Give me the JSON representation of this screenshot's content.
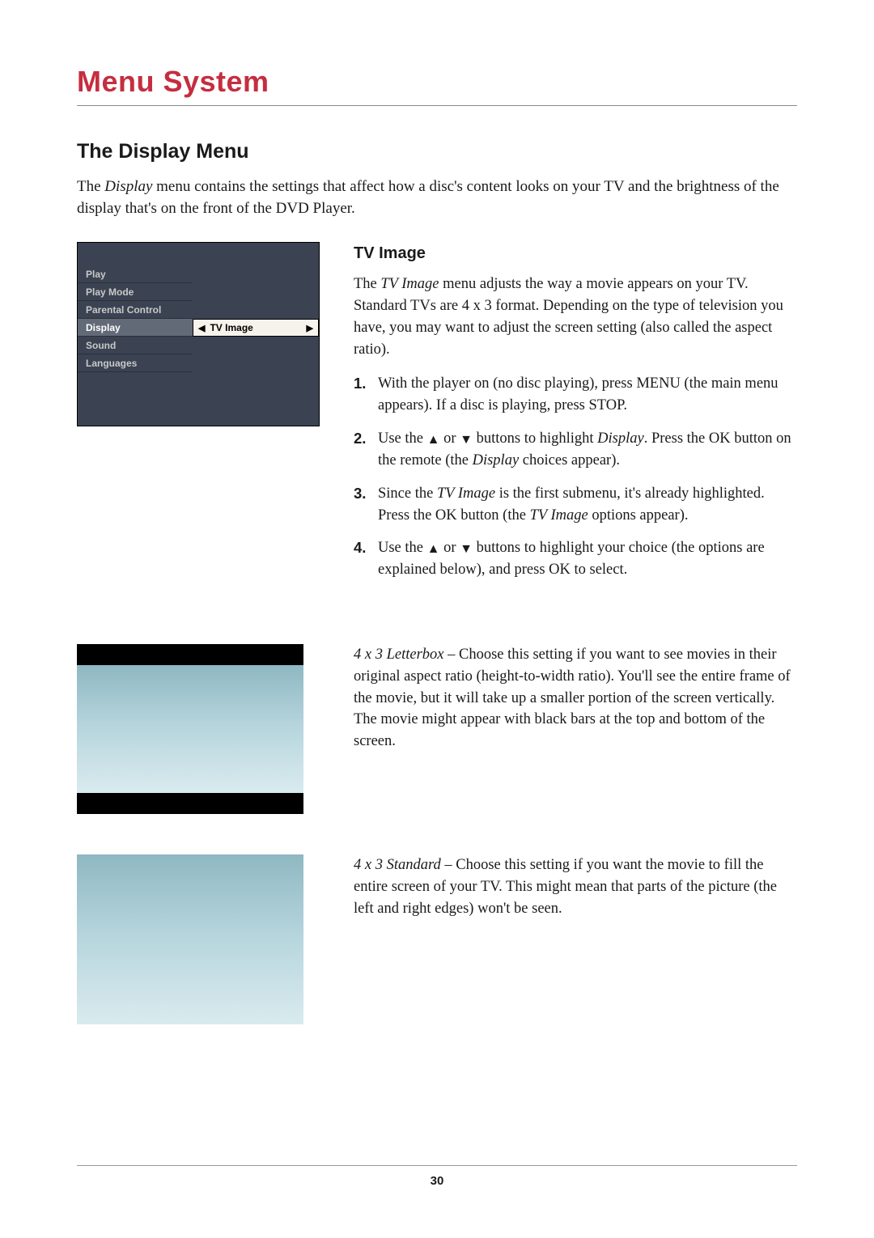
{
  "page_title": "Menu System",
  "section_heading": "The Display Menu",
  "intro_pre": "The ",
  "intro_em": "Display",
  "intro_post": " menu contains the settings that affect how a disc's content looks on your TV and the brightness of the display that's on the front of the DVD Player.",
  "menu": {
    "items": [
      "Play",
      "Play Mode",
      "Parental Control",
      "Display",
      "Sound",
      "Languages"
    ],
    "submenu_label": "TV Image"
  },
  "tv_image": {
    "heading": "TV Image",
    "intro_pre": "The ",
    "intro_em": "TV Image",
    "intro_post": " menu adjusts the way a movie appears on your TV. Standard TVs are 4 x 3 format. Depending on the type of television you have, you may want to adjust the screen setting (also called the aspect ratio).",
    "steps": [
      {
        "num": "1.",
        "text": "With the player on (no disc playing), press MENU (the main menu appears). If a disc is playing, press STOP."
      },
      {
        "num": "2.",
        "pre": "Use the ",
        "mid": " or ",
        "post_pre": " buttons to highlight ",
        "post_em": "Display",
        "post_tail": ". Press the OK button on the remote (the ",
        "post_em2": "Display",
        "post_end": " choices appear)."
      },
      {
        "num": "3.",
        "pre": "Since the ",
        "em": "TV Image",
        "mid": " is the first submenu, it's already highlighted. Press the OK button (the ",
        "em2": "TV Image",
        "end": " options appear)."
      },
      {
        "num": "4.",
        "pre": "Use the ",
        "mid": " or ",
        "post": " buttons to highlight your choice (the options are explained below), and press OK to select."
      }
    ]
  },
  "letterbox": {
    "lead": "4 x 3 Letterbox",
    "dash": " – ",
    "body": "Choose this setting if you want to see movies in their original aspect ratio (height-to-width ratio). You'll see the entire frame of the movie, but it will take up a smaller portion of the screen vertically. The movie might appear with black bars at the top and bottom of the screen."
  },
  "standard": {
    "lead": "4 x 3 Standard",
    "dash": " – ",
    "body": "Choose this setting if you want the movie to fill the entire screen of your TV. This might mean that parts of the picture (the left and right edges) won't be seen."
  },
  "page_number": "30"
}
